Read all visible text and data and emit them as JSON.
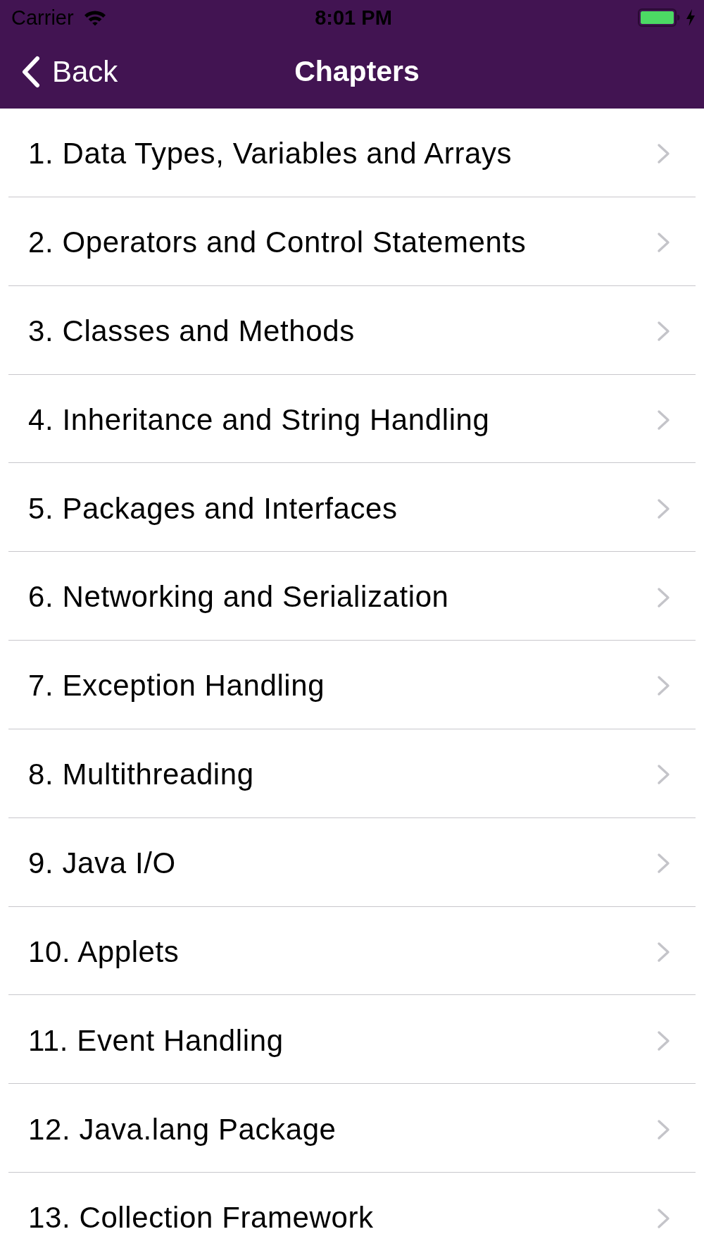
{
  "status_bar": {
    "carrier": "Carrier",
    "time": "8:01 PM",
    "charging": true
  },
  "nav_bar": {
    "back_label": "Back",
    "title": "Chapters"
  },
  "chapters": [
    "1. Data Types, Variables and Arrays",
    "2. Operators and Control Statements",
    "3. Classes and Methods",
    "4. Inheritance and String Handling",
    "5. Packages and Interfaces",
    "6. Networking and Serialization",
    "7. Exception Handling",
    "8. Multithreading",
    "9. Java I/O",
    "10. Applets",
    "11. Event Handling",
    "12. Java.lang Package",
    "13. Collection Framework"
  ]
}
